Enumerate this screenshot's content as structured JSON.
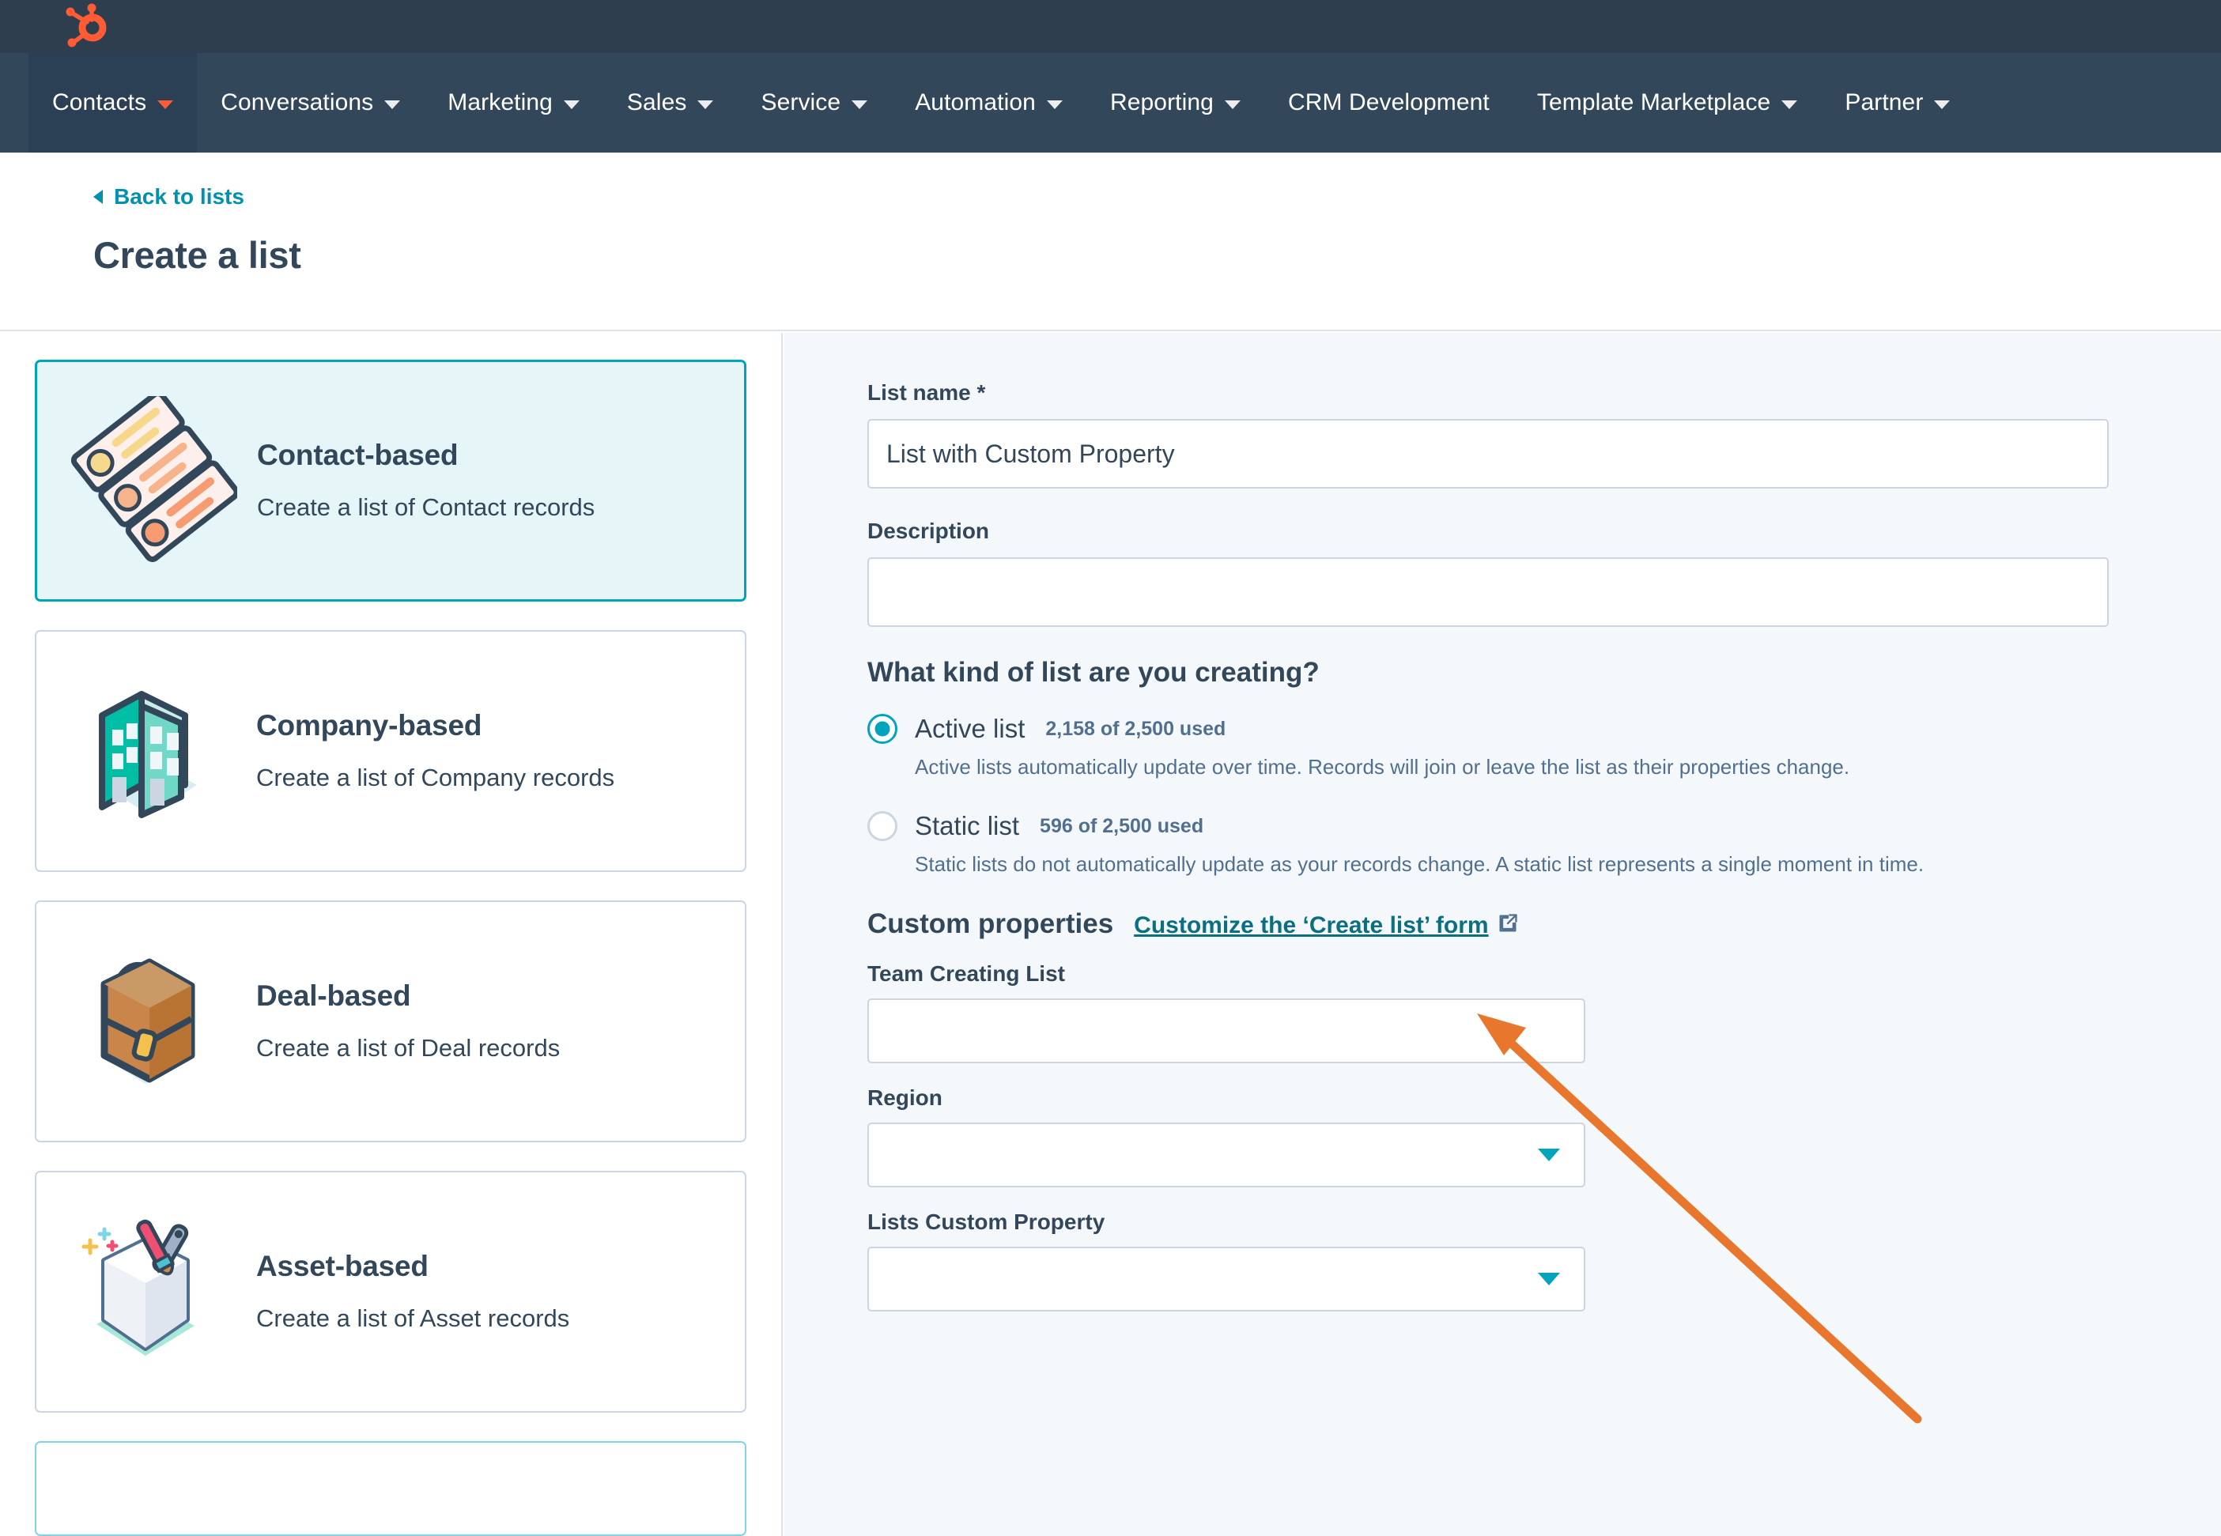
{
  "brand": {
    "logo_name": "hubspot-sprocket-logo",
    "nav_bg": "#33475b",
    "topbar_bg": "#2e3e4f",
    "accent_orange": "#ff5c35",
    "accent_teal": "#00a4bd",
    "link_teal": "#0091ae"
  },
  "nav": {
    "items": [
      {
        "label": "Contacts",
        "has_chevron": true,
        "active": true
      },
      {
        "label": "Conversations",
        "has_chevron": true,
        "active": false
      },
      {
        "label": "Marketing",
        "has_chevron": true,
        "active": false
      },
      {
        "label": "Sales",
        "has_chevron": true,
        "active": false
      },
      {
        "label": "Service",
        "has_chevron": true,
        "active": false
      },
      {
        "label": "Automation",
        "has_chevron": true,
        "active": false
      },
      {
        "label": "Reporting",
        "has_chevron": true,
        "active": false
      },
      {
        "label": "CRM Development",
        "has_chevron": false,
        "active": false
      },
      {
        "label": "Template Marketplace",
        "has_chevron": true,
        "active": false
      },
      {
        "label": "Partner",
        "has_chevron": true,
        "active": false
      }
    ]
  },
  "header": {
    "back_label": "Back to lists",
    "title": "Create a list"
  },
  "list_types": [
    {
      "title": "Contact-based",
      "description": "Create a list of Contact records",
      "icon": "contact-cards-icon",
      "selected": true
    },
    {
      "title": "Company-based",
      "description": "Create a list of Company records",
      "icon": "office-building-icon",
      "selected": false
    },
    {
      "title": "Deal-based",
      "description": "Create a list of Deal records",
      "icon": "briefcase-icon",
      "selected": false
    },
    {
      "title": "Asset-based",
      "description": "Create a list of Asset records",
      "icon": "asset-cube-tools-icon",
      "selected": false
    }
  ],
  "form": {
    "list_name": {
      "label": "List name *",
      "value": "List with Custom Property",
      "placeholder": ""
    },
    "description": {
      "label": "Description",
      "value": "",
      "placeholder": ""
    },
    "kind_question": "What kind of list are you creating?",
    "kind_options": [
      {
        "label": "Active list",
        "usage": "2,158 of 2,500 used",
        "help": "Active lists automatically update over time. Records will join or leave the list as their properties change.",
        "selected": true
      },
      {
        "label": "Static list",
        "usage": "596 of 2,500 used",
        "help": "Static lists do not automatically update as your records change. A static list represents a single moment in time.",
        "selected": false
      }
    ],
    "custom_properties": {
      "title": "Custom properties",
      "link_label": "Customize the ‘Create list’ form",
      "link_icon": "external-link-icon",
      "fields": [
        {
          "label": "Team Creating List",
          "type": "text",
          "value": "",
          "placeholder": ""
        },
        {
          "label": "Region",
          "type": "select",
          "value": "",
          "placeholder": ""
        },
        {
          "label": "Lists Custom Property",
          "type": "select",
          "value": "",
          "placeholder": ""
        }
      ]
    }
  },
  "annotation": {
    "type": "arrow",
    "color": "#e8762c",
    "points_to": "Customize the ‘Create list’ form"
  }
}
